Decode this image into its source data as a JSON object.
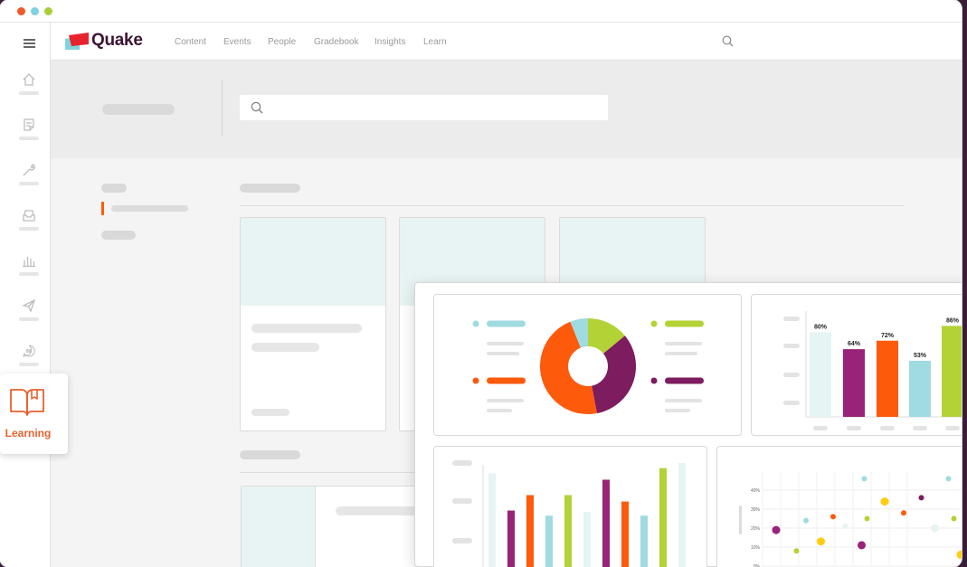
{
  "window": {
    "traffic_lights": [
      "#f0592a",
      "#7fd3dc",
      "#a6cf3a"
    ]
  },
  "app": {
    "name": "Quake",
    "brand_colors": {
      "logo_red": "#e8232d",
      "logo_teal": "#7fd3dc",
      "text": "#3d1533"
    }
  },
  "topnav": {
    "links": [
      "Content",
      "Events",
      "People",
      "Gradebook",
      "Insights",
      "Learn"
    ],
    "search_icon": "search-icon"
  },
  "sidebar": {
    "items": [
      {
        "icon": "home-icon"
      },
      {
        "icon": "document-icon"
      },
      {
        "icon": "wrench-icon"
      },
      {
        "icon": "inbox-icon"
      },
      {
        "icon": "bar-chart-icon"
      },
      {
        "icon": "send-icon"
      },
      {
        "icon": "chat-icon"
      }
    ],
    "active_popout": {
      "icon": "book-icon",
      "label": "Learning"
    }
  },
  "banner": {
    "search_icon": "search-icon",
    "search_placeholder": ""
  },
  "dashboard": {
    "colors": {
      "teal": "#9fdbe0",
      "lime": "#b3d236",
      "orange": "#fd5a0b",
      "plum": "#7d1c5e",
      "magenta": "#992378",
      "pale": "#e6f4f3"
    }
  },
  "chart_data": [
    {
      "type": "pie",
      "title": "",
      "donut": true,
      "slices": [
        {
          "color": "#b3d236",
          "value": 14
        },
        {
          "color": "#7d1c5e",
          "value": 33
        },
        {
          "color": "#fd5a0b",
          "value": 47
        },
        {
          "color": "#9fdbe0",
          "value": 6
        }
      ]
    },
    {
      "type": "bar",
      "title": "",
      "ylim": [
        0,
        100
      ],
      "data_labels": [
        "80%",
        "64%",
        "72%",
        "53%",
        "86%"
      ],
      "values": [
        80,
        64,
        72,
        53,
        86
      ],
      "colors": [
        "#e6f4f3",
        "#992378",
        "#fd5a0b",
        "#9fdbe0",
        "#b3d236"
      ]
    },
    {
      "type": "bar",
      "title": "",
      "ylim": [
        0,
        100
      ],
      "values": [
        92,
        63,
        75,
        59,
        75,
        62,
        87,
        70,
        59,
        96,
        100
      ],
      "colors": [
        "#e6f4f3",
        "#992378",
        "#fd5a0b",
        "#9fdbe0",
        "#b3d236",
        "#e6f4f3",
        "#992378",
        "#fd5a0b",
        "#9fdbe0",
        "#b3d236",
        "#e6f4f3"
      ]
    },
    {
      "type": "scatter",
      "title": "",
      "y_tick_labels": [
        "40%",
        "30%",
        "20%",
        "10%",
        "0%"
      ],
      "ylim": [
        0,
        40
      ],
      "points": [
        {
          "x": 1,
          "y": 19,
          "color": "#992378"
        },
        {
          "x": 2.5,
          "y": 8,
          "color": "#b3d236"
        },
        {
          "x": 3.2,
          "y": 24,
          "color": "#9fdbe0"
        },
        {
          "x": 4.3,
          "y": 13,
          "color": "#ffcc11"
        },
        {
          "x": 5.2,
          "y": 26,
          "color": "#fd5a0b"
        },
        {
          "x": 6.1,
          "y": 21,
          "color": "#e6f4f3"
        },
        {
          "x": 7.3,
          "y": 11,
          "color": "#992378"
        },
        {
          "x": 7.5,
          "y": 46,
          "color": "#9fdbe0"
        },
        {
          "x": 7.7,
          "y": 25,
          "color": "#b3d236"
        },
        {
          "x": 9,
          "y": 34,
          "color": "#ffcc11"
        },
        {
          "x": 10.4,
          "y": 28,
          "color": "#fd5a0b"
        },
        {
          "x": 11.7,
          "y": 36,
          "color": "#7d1c5e"
        },
        {
          "x": 12.7,
          "y": 20,
          "color": "#e6f4f3"
        },
        {
          "x": 13.7,
          "y": 46,
          "color": "#9fdbe0"
        },
        {
          "x": 14.1,
          "y": 25,
          "color": "#b3d236"
        },
        {
          "x": 14.6,
          "y": 6,
          "color": "#ffcc11"
        }
      ]
    }
  ]
}
